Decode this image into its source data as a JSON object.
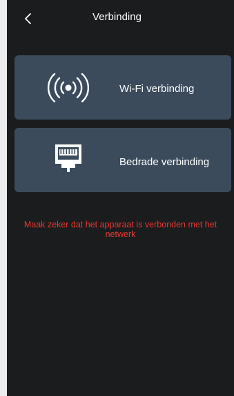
{
  "header": {
    "title": "Verbinding",
    "back_icon": "chevron-left-icon"
  },
  "options": [
    {
      "label": "Wi-Fi verbinding",
      "icon": "wifi-signal-icon"
    },
    {
      "label": "Bedrade verbinding",
      "icon": "ethernet-port-icon"
    }
  ],
  "warning": {
    "line1": "Maak zeker dat het apparaat is verbonden met het",
    "line2": "netwerk"
  },
  "colors": {
    "background": "#1b1c1e",
    "card": "#3b4b5c",
    "text": "#ffffff",
    "warning": "#e8382f",
    "outer": "#ececec"
  }
}
